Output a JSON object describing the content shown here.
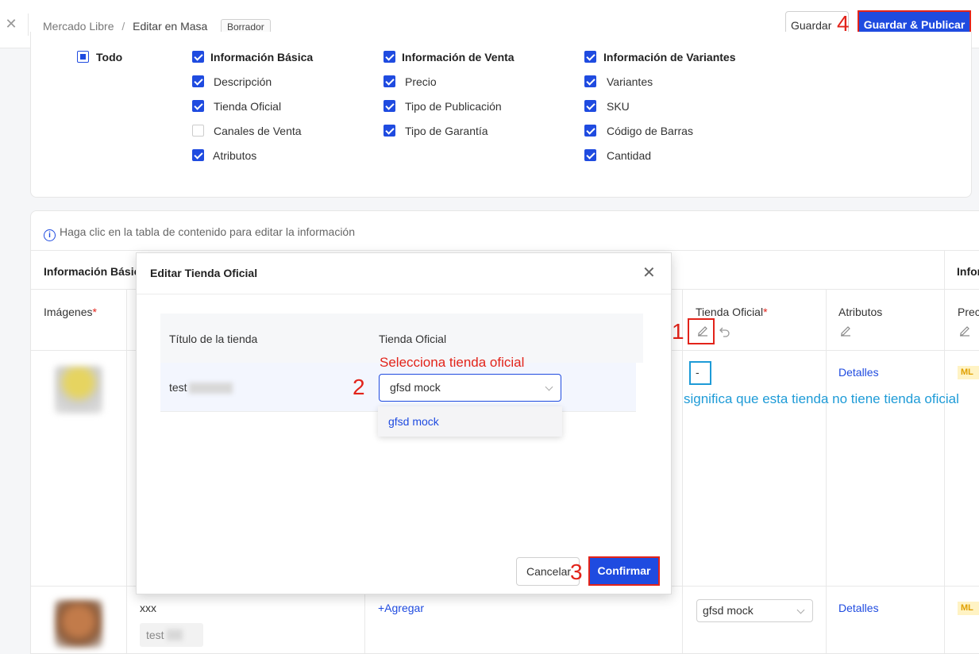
{
  "topbar": {
    "breadcrumb_root": "Mercado Libre",
    "breadcrumb_sep": "/",
    "breadcrumb_current": "Editar en Masa",
    "status_badge": "Borrador",
    "save_label": "Guardar",
    "publish_label": "Guardar & Publicar"
  },
  "filters": {
    "todo": "Todo",
    "basic": {
      "title": "Información Básica",
      "items": [
        "Descripción",
        "Tienda Oficial",
        "Canales de Venta",
        "Atributos"
      ]
    },
    "sale": {
      "title": "Información de Venta",
      "items": [
        "Precio",
        "Tipo de Publicación",
        "Tipo de Garantía"
      ]
    },
    "variants": {
      "title": "Información de Variantes",
      "items": [
        "Variantes",
        "SKU",
        "Código de Barras",
        "Cantidad"
      ]
    }
  },
  "table": {
    "hint": "Haga clic en la tabla de contenido para editar la información",
    "group_basic": "Información Básica",
    "group_right": "Información de Venta",
    "col_images": "Imágenes",
    "col_store": "Tienda Oficial",
    "col_attributes": "Atributos",
    "col_price": "Precio",
    "required_mark": "*",
    "row1": {
      "store": "-",
      "details": "Detalles",
      "tag": "ML"
    },
    "row2": {
      "title": "xxx",
      "store_name": "test",
      "add_link": "+Agregar",
      "store_select": "gfsd mock",
      "details": "Detalles",
      "tag": "ML"
    }
  },
  "modal": {
    "title": "Editar Tienda Oficial",
    "col_store_title": "Título de la tienda",
    "col_official_store": "Tienda Oficial",
    "row_store_title": "test",
    "selected_value": "gfsd mock",
    "dropdown_options": [
      "gfsd mock"
    ],
    "cancel_label": "Cancelar",
    "confirm_label": "Confirmar"
  },
  "annotations": {
    "step1": "1",
    "step2": "2",
    "step3": "3",
    "step4": "4",
    "select_hint": "Selecciona tienda oficial",
    "dash_note": "significa que esta tienda no tiene tienda oficial",
    "red_color": "#e2231a",
    "blue_color": "#1e9bd7"
  },
  "colors": {
    "primary": "#1f4be0",
    "background": "#f5f6f8"
  }
}
